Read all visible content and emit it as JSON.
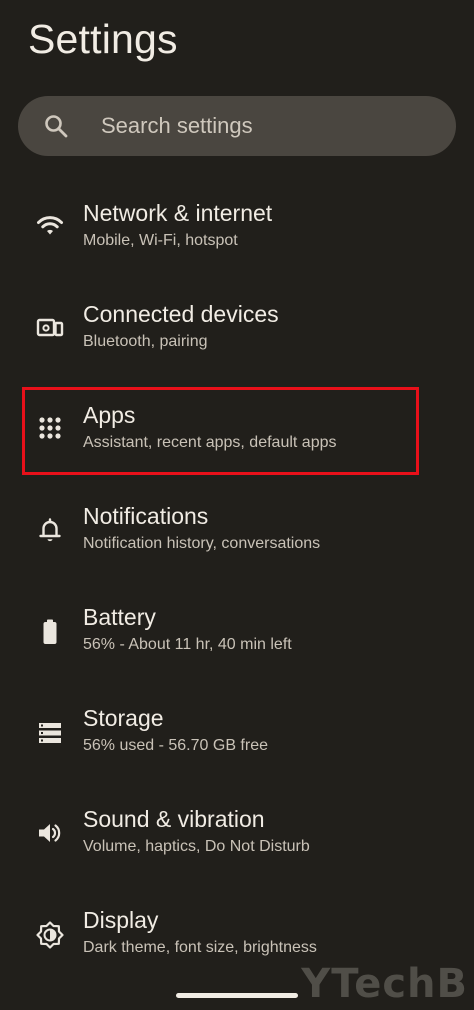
{
  "header": {
    "title": "Settings"
  },
  "search": {
    "placeholder": "Search settings"
  },
  "items": [
    {
      "key": "network",
      "title": "Network & internet",
      "subtitle": "Mobile, Wi-Fi, hotspot",
      "icon": "wifi-icon"
    },
    {
      "key": "devices",
      "title": "Connected devices",
      "subtitle": "Bluetooth, pairing",
      "icon": "connected-devices-icon"
    },
    {
      "key": "apps",
      "title": "Apps",
      "subtitle": "Assistant, recent apps, default apps",
      "icon": "apps-grid-icon"
    },
    {
      "key": "notifications",
      "title": "Notifications",
      "subtitle": "Notification history, conversations",
      "icon": "bell-icon"
    },
    {
      "key": "battery",
      "title": "Battery",
      "subtitle": "56% - About 11 hr, 40 min left",
      "icon": "battery-icon"
    },
    {
      "key": "storage",
      "title": "Storage",
      "subtitle": "56% used - 56.70 GB free",
      "icon": "storage-icon"
    },
    {
      "key": "sound",
      "title": "Sound & vibration",
      "subtitle": "Volume, haptics, Do Not Disturb",
      "icon": "speaker-icon"
    },
    {
      "key": "display",
      "title": "Display",
      "subtitle": "Dark theme, font size, brightness",
      "icon": "brightness-icon"
    }
  ],
  "watermark": "YTechB",
  "colors": {
    "background": "#211f1b",
    "search_bar": "#4a4640",
    "highlight": "#e8101a",
    "text_primary": "#f1ece4",
    "text_secondary": "#c9c2b7"
  }
}
